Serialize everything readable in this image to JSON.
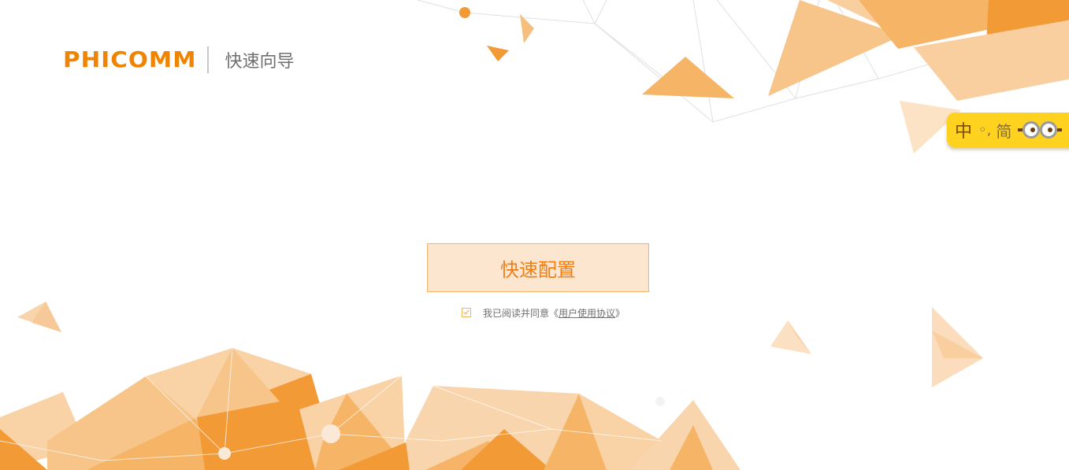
{
  "brand": {
    "logo_text": "PHICOMM",
    "title": "快速向导"
  },
  "language_switch": {
    "current": "中",
    "punct": "◦,",
    "simplified": "简"
  },
  "main": {
    "quick_setup_label": "快速配置",
    "agreement": {
      "checked": true,
      "prefix": "我已阅读并同意《",
      "link_text": "用户使用协议",
      "suffix": "》"
    }
  },
  "colors": {
    "brand_orange": "#f08300",
    "button_bg": "#fde6cf",
    "button_border": "#f6b36a",
    "badge_yellow": "#ffd21f"
  }
}
